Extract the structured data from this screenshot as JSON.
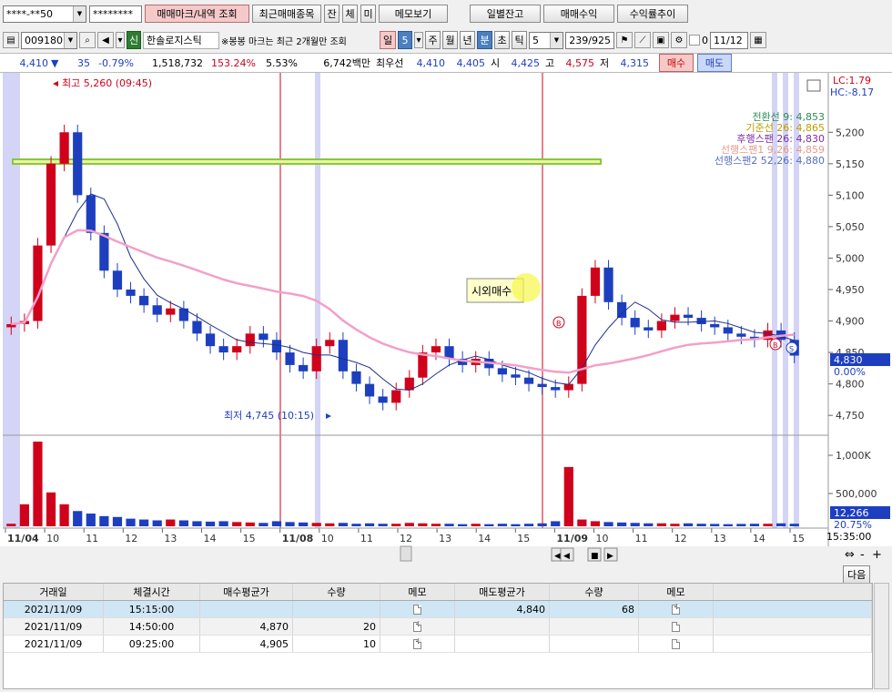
{
  "toolbar1": {
    "account": "****-**50",
    "password": "********",
    "buttons": [
      "매매마크/내역 조회",
      "최근매매종목",
      "잔",
      "체",
      "미",
      "메모보기",
      "일별잔고",
      "매매수익",
      "수익률추이"
    ]
  },
  "toolbar2": {
    "code": "009180",
    "credit_badge": "신",
    "stock_name": "한솔로지스틱",
    "note": "※봉봉 마크는 최근 2개월만 조회",
    "periods": [
      "일",
      "5",
      "주",
      "월",
      "년",
      "분",
      "초",
      "틱"
    ],
    "interval": "5",
    "count": "239/925",
    "date": "11/12",
    "check_label": "0"
  },
  "quote": {
    "price": "4,410",
    "direction": "▼",
    "change": "35",
    "change_pct": "-0.79%",
    "volume": "1,518,732",
    "vol_ratio": "153.24%",
    "turnover": "5.53%",
    "amount": "6,742백만",
    "label_best": "최우선",
    "ask": "4,410",
    "bid": "4,405",
    "label_open": "시",
    "open": "4,425",
    "label_high": "고",
    "high": "4,575",
    "label_low": "저",
    "low": "4,315",
    "buy_label": "매수",
    "sell_label": "매도"
  },
  "chart_labels": {
    "high_marker": "최고 5,260 (09:45)",
    "low_marker": "최저 4,745 (10:15)",
    "tooltip": "시외매수",
    "lc": "LC:1.79",
    "hc": "HC:-8.17",
    "current_price": "4,830",
    "current_pct": "0.00%",
    "volume_value": "12,266",
    "volume_pct": "20.75%",
    "time_label": "15:35:00",
    "next_button": "다음"
  },
  "chart_data": {
    "type": "candlestick",
    "legend": [
      {
        "name": "전환선 9: 4,853",
        "color": "#2e8b57"
      },
      {
        "name": "기준선 26: 4,865",
        "color": "#b8a000"
      },
      {
        "name": "후행스팬 26: 4,830",
        "color": "#7a2ca8"
      },
      {
        "name": "선행스팬1 9,26: 4,859",
        "color": "#e69a8a"
      },
      {
        "name": "선행스팬2 52,26: 4,880",
        "color": "#5570c0"
      }
    ],
    "y_ticks": [
      5200,
      5150,
      5100,
      5050,
      5000,
      4950,
      4900,
      4850,
      4800,
      4750
    ],
    "ylim": [
      4730,
      5280
    ],
    "volume_ticks": [
      "1,000K",
      "500,000"
    ],
    "x_ticks": [
      "11/04",
      "10",
      "11",
      "12",
      "13",
      "14",
      "15",
      "11/08",
      "10",
      "11",
      "12",
      "13",
      "14",
      "15",
      "11/09",
      "10",
      "11",
      "12",
      "13",
      "14",
      "15"
    ],
    "close": [
      4895,
      4900,
      5020,
      5150,
      5200,
      5100,
      5040,
      4980,
      4950,
      4940,
      4925,
      4910,
      4920,
      4900,
      4880,
      4860,
      4850,
      4860,
      4880,
      4870,
      4850,
      4830,
      4820,
      4860,
      4870,
      4820,
      4800,
      4780,
      4770,
      4790,
      4810,
      4850,
      4860,
      4840,
      4830,
      4840,
      4825,
      4815,
      4810,
      4800,
      4795,
      4790,
      4800,
      4940,
      4985,
      4930,
      4905,
      4890,
      4885,
      4900,
      4910,
      4905,
      4895,
      4890,
      4880,
      4875,
      4870,
      4885,
      4870,
      4845
    ],
    "volume": [
      30,
      260,
      1000,
      400,
      260,
      180,
      150,
      120,
      110,
      90,
      80,
      70,
      80,
      70,
      60,
      55,
      60,
      50,
      45,
      40,
      60,
      50,
      45,
      40,
      35,
      40,
      30,
      35,
      30,
      30,
      40,
      35,
      30,
      30,
      25,
      30,
      25,
      30,
      25,
      30,
      35,
      60,
      700,
      80,
      60,
      50,
      45,
      40,
      35,
      35,
      30,
      35,
      30,
      28,
      25,
      28,
      30,
      30,
      35,
      30
    ],
    "reference_line": 5135,
    "trades": [
      {
        "date": "2021/11/09",
        "time": "15:15:00",
        "buy_avg": "",
        "buy_qty": "",
        "sell_avg": "4,840",
        "sell_qty": "68"
      },
      {
        "date": "2021/11/09",
        "time": "14:50:00",
        "buy_avg": "4,870",
        "buy_qty": "20",
        "sell_avg": "",
        "sell_qty": ""
      },
      {
        "date": "2021/11/09",
        "time": "09:25:00",
        "buy_avg": "4,905",
        "buy_qty": "10",
        "sell_avg": "",
        "sell_qty": ""
      }
    ]
  },
  "table": {
    "headers": [
      "거래일",
      "체결시간",
      "매수평균가",
      "수량",
      "메모",
      "매도평균가",
      "수량",
      "메모"
    ]
  },
  "colors": {
    "up": "#d0021b",
    "down": "#1d3fbf",
    "session_band": "#d4d4f6"
  }
}
